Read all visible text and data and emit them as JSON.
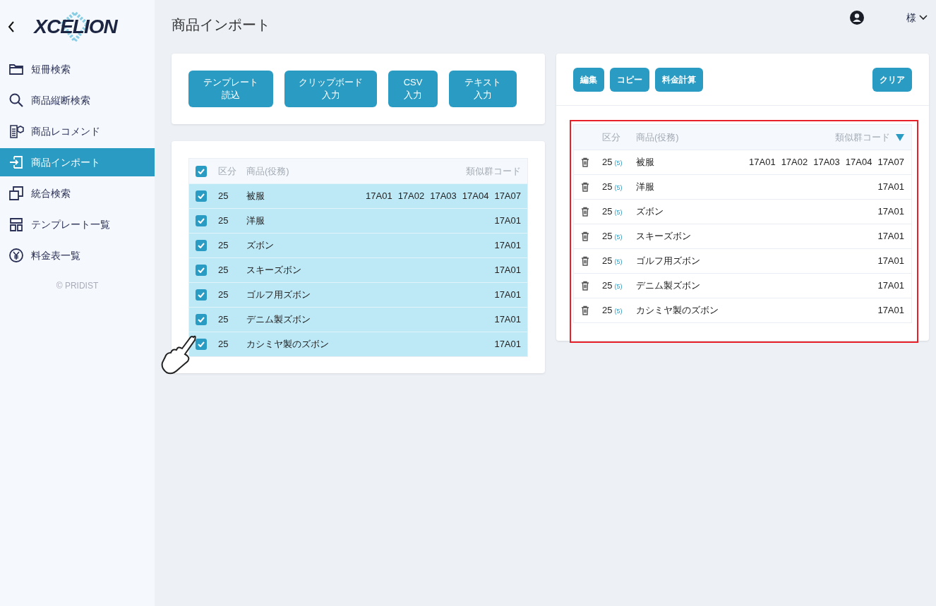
{
  "sidebar": {
    "logo": "XCELION",
    "items": [
      {
        "label": "短冊検索",
        "selected": false
      },
      {
        "label": "商品縦断検索",
        "selected": false
      },
      {
        "label": "商品レコメンド",
        "selected": false
      },
      {
        "label": "商品インポート",
        "selected": true
      },
      {
        "label": "統合検索",
        "selected": false
      },
      {
        "label": "テンプレート一覧",
        "selected": false
      },
      {
        "label": "料金表一覧",
        "selected": false
      }
    ],
    "footer": "© PRIDIST"
  },
  "header": {
    "title": "商品インポート",
    "user": "様"
  },
  "import_buttons": [
    "テンプレート読込",
    "クリップボード入力",
    "CSV入力",
    "テキスト入力"
  ],
  "import_table": {
    "all_checked": true,
    "columns": [
      "区分",
      "商品(役務)",
      "類似群コード"
    ],
    "rows": [
      {
        "checked": true,
        "class": "25",
        "name": "被服",
        "codes": [
          "17A01",
          "17A02",
          "17A03",
          "17A04",
          "17A07"
        ]
      },
      {
        "checked": true,
        "class": "25",
        "name": "洋服",
        "codes": [
          "17A01"
        ]
      },
      {
        "checked": true,
        "class": "25",
        "name": "ズボン",
        "codes": [
          "17A01"
        ]
      },
      {
        "checked": true,
        "class": "25",
        "name": "スキーズボン",
        "codes": [
          "17A01"
        ]
      },
      {
        "checked": true,
        "class": "25",
        "name": "ゴルフ用ズボン",
        "codes": [
          "17A01"
        ]
      },
      {
        "checked": true,
        "class": "25",
        "name": "デニム製ズボン",
        "codes": [
          "17A01"
        ]
      },
      {
        "checked": true,
        "class": "25",
        "name": "カシミヤ製のズボン",
        "codes": [
          "17A01"
        ]
      }
    ]
  },
  "result_panel": {
    "actions": [
      "編集",
      "コピー",
      "料金計算"
    ],
    "clear": "クリア",
    "highlighted": true,
    "columns": [
      "区分",
      "商品(役務)",
      "類似群コード"
    ],
    "rows": [
      {
        "class": "25",
        "count": "(5)",
        "name": "被服",
        "codes": [
          "17A01",
          "17A02",
          "17A03",
          "17A04",
          "17A07"
        ]
      },
      {
        "class": "25",
        "count": "(5)",
        "name": "洋服",
        "codes": [
          "17A01"
        ]
      },
      {
        "class": "25",
        "count": "(5)",
        "name": "ズボン",
        "codes": [
          "17A01"
        ]
      },
      {
        "class": "25",
        "count": "(5)",
        "name": "スキーズボン",
        "codes": [
          "17A01"
        ]
      },
      {
        "class": "25",
        "count": "(5)",
        "name": "ゴルフ用ズボン",
        "codes": [
          "17A01"
        ]
      },
      {
        "class": "25",
        "count": "(5)",
        "name": "デニム製ズボン",
        "codes": [
          "17A01"
        ]
      },
      {
        "class": "25",
        "count": "(5)",
        "name": "カシミヤ製のズボン",
        "codes": [
          "17A01"
        ]
      }
    ]
  }
}
